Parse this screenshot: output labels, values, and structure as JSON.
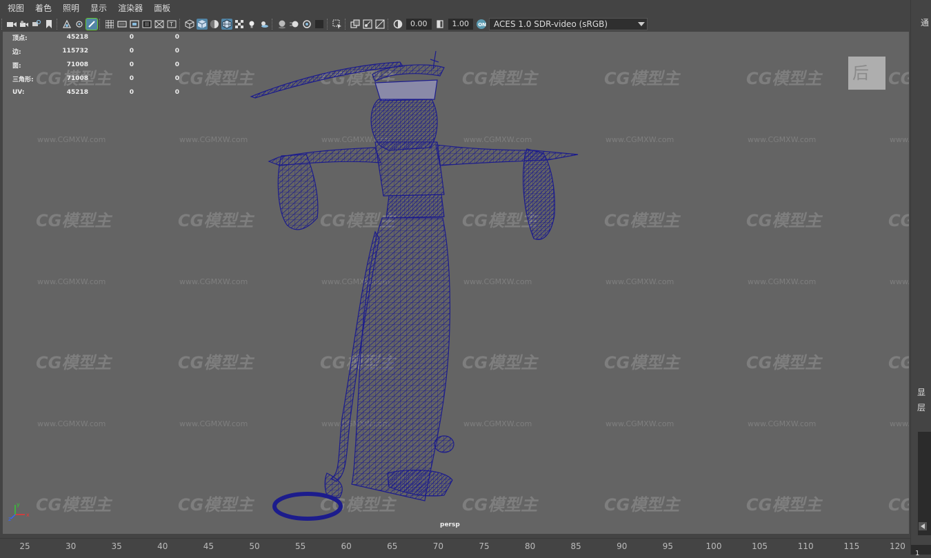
{
  "menubar": {
    "items": [
      {
        "label": "视图"
      },
      {
        "label": "着色"
      },
      {
        "label": "照明"
      },
      {
        "label": "显示"
      },
      {
        "label": "渲染器"
      },
      {
        "label": "面板"
      }
    ]
  },
  "toolbar": {
    "icons": [
      "camera-icon",
      "camera-attributes-icon",
      "bookmark-icon",
      "image-plane-icon",
      "grid-icon",
      "film-gate-icon",
      "resolution-gate-icon",
      "gate-mask-icon",
      "field-chart-icon",
      "safe-action-icon",
      "wireframe-icon",
      "smooth-shade-icon",
      "default-material-icon",
      "wireframe-on-shaded-icon",
      "textured-icon",
      "use-all-lights-icon",
      "shadows-icon",
      "screen-space-ao-icon",
      "motion-blur-icon",
      "anti-aliasing-icon",
      "depth-of-field-icon",
      "isolate-select-icon",
      "xray-icon",
      "xray-joints-icon",
      "xray-active-components-icon",
      "backface-culling-icon",
      "exposure-icon",
      "gamma-icon",
      "color-management-icon"
    ],
    "exposure_value": "0.00",
    "gamma_value": "1.00",
    "color_space": "ACES 1.0 SDR-video (sRGB)",
    "accent_color": "#5285a6",
    "active_outline_color": "#66cc33"
  },
  "hud": {
    "rows": [
      {
        "label": "顶点:",
        "total": "45218",
        "selected": "0",
        "components": "0"
      },
      {
        "label": "边:",
        "total": "115732",
        "selected": "0",
        "components": "0"
      },
      {
        "label": "面:",
        "total": "71008",
        "selected": "0",
        "components": "0"
      },
      {
        "label": "三角形:",
        "total": "71008",
        "selected": "0",
        "components": "0"
      },
      {
        "label": "UV:",
        "total": "45218",
        "selected": "0",
        "components": "0"
      }
    ]
  },
  "viewport": {
    "camera_label": "persp",
    "background_color": "#646464",
    "wireframe_color": "#1c1c8c",
    "axis": {
      "x": "x",
      "y": "y",
      "z": "z"
    }
  },
  "watermark": {
    "logo_text": "CG模型主",
    "url_text": "www.CGMXW.com",
    "cube_text": "后"
  },
  "timeline": {
    "ticks": [
      "25",
      "30",
      "35",
      "40",
      "45",
      "50",
      "55",
      "60",
      "65",
      "70",
      "75",
      "80",
      "85",
      "90",
      "95",
      "100",
      "105",
      "110",
      "115",
      "120"
    ]
  },
  "right_panel": {
    "top_label": "通",
    "label_1": "显",
    "label_2": "层",
    "frame_value": "1"
  }
}
